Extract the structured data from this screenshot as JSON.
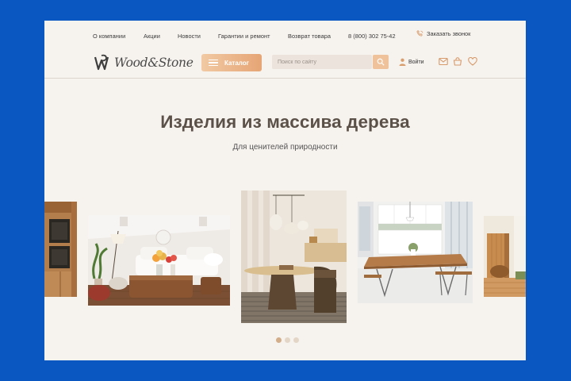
{
  "nav": {
    "items": [
      "О компании",
      "Акции",
      "Новости",
      "Гарантии и ремонт",
      "Возврат товара"
    ],
    "phone": "8 (800) 302 75-42",
    "callback": "Заказать звонок"
  },
  "logo": {
    "text": "Wood&Stone"
  },
  "catalog": {
    "label": "Каталог"
  },
  "search": {
    "placeholder": "Поиск по сайту"
  },
  "login": {
    "label": "Войти"
  },
  "icons": [
    "phone-icon",
    "burger-icon",
    "search-icon",
    "user-icon",
    "mail-icon",
    "cart-icon",
    "heart-icon"
  ],
  "hero": {
    "title": "Изделия из массива дерева",
    "subtitle": "Для ценителей природности"
  },
  "slider": {
    "slides": [
      "Kitchen interior",
      "Living room",
      "Dining area",
      "Dining table",
      "Wood panels"
    ],
    "active_index": 0,
    "dots": 3
  },
  "colors": {
    "frame": "#0b57c2",
    "page": "#f6f2ee",
    "accent": "#e8a979"
  }
}
